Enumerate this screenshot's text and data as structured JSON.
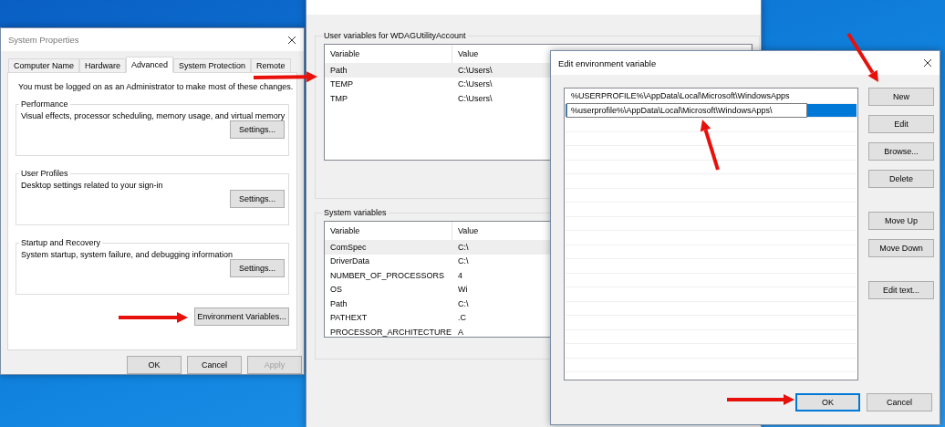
{
  "system_properties": {
    "title": "System Properties",
    "tabs": [
      {
        "label": "Computer Name",
        "selected": false
      },
      {
        "label": "Hardware",
        "selected": false
      },
      {
        "label": "Advanced",
        "selected": true
      },
      {
        "label": "System Protection",
        "selected": false
      },
      {
        "label": "Remote",
        "selected": false
      }
    ],
    "notice": "You must be logged on as an Administrator to make most of these changes.",
    "groups": [
      {
        "title": "Performance",
        "description": "Visual effects, processor scheduling, memory usage, and virtual memory",
        "button": "Settings..."
      },
      {
        "title": "User Profiles",
        "description": "Desktop settings related to your sign-in",
        "button": "Settings..."
      },
      {
        "title": "Startup and Recovery",
        "description": "System startup, system failure, and debugging information",
        "button": "Settings..."
      }
    ],
    "environment_button": "Environment Variables...",
    "buttons": [
      {
        "label": "OK",
        "disabled": false
      },
      {
        "label": "Cancel",
        "disabled": false
      },
      {
        "label": "Apply",
        "disabled": true
      }
    ]
  },
  "environment_variables": {
    "user_group": {
      "title": "User variables for WDAGUtilityAccount",
      "columns": [
        "Variable",
        "Value"
      ],
      "rows": [
        {
          "variable": "Path",
          "value": "C:\\Users\\",
          "selected": true
        },
        {
          "variable": "TEMP",
          "value": "C:\\Users\\",
          "selected": false
        },
        {
          "variable": "TMP",
          "value": "C:\\Users\\",
          "selected": false
        }
      ]
    },
    "system_group": {
      "title": "System variables",
      "columns": [
        "Variable",
        "Value"
      ],
      "rows": [
        {
          "variable": "ComSpec",
          "value": "C:\\",
          "selected": true
        },
        {
          "variable": "DriverData",
          "value": "C:\\",
          "selected": false
        },
        {
          "variable": "NUMBER_OF_PROCESSORS",
          "value": "4",
          "selected": false
        },
        {
          "variable": "OS",
          "value": "Wi",
          "selected": false
        },
        {
          "variable": "Path",
          "value": "C:\\",
          "selected": false
        },
        {
          "variable": "PATHEXT",
          "value": ".C",
          "selected": false
        },
        {
          "variable": "PROCESSOR_ARCHITECTURE",
          "value": "A",
          "selected": false
        }
      ]
    }
  },
  "edit_dialog": {
    "title": "Edit environment variable",
    "entries": [
      {
        "kind": "text",
        "text": "%USERPROFILE%\\AppData\\Local\\Microsoft\\WindowsApps",
        "selected": false
      },
      {
        "kind": "editing",
        "text": "%userprofile%\\AppData\\Local\\Microsoft\\WindowsApps\\",
        "selected": true
      }
    ],
    "side_button_groups": [
      [
        "New",
        "Edit",
        "Browse...",
        "Delete"
      ],
      [
        "Move Up",
        "Move Down"
      ],
      [
        "Edit text..."
      ]
    ],
    "footer_buttons": [
      {
        "label": "OK",
        "focused": true
      },
      {
        "label": "Cancel",
        "focused": false
      }
    ]
  }
}
